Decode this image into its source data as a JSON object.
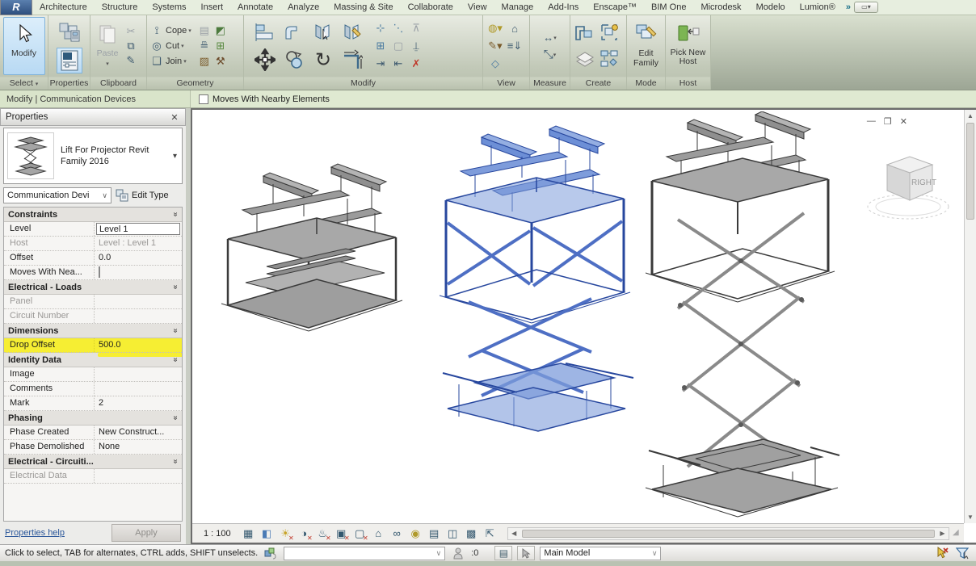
{
  "app": {
    "logo_letter": "R"
  },
  "ribbon": {
    "tabs": [
      "Architecture",
      "Structure",
      "Systems",
      "Insert",
      "Annotate",
      "Analyze",
      "Massing & Site",
      "Collaborate",
      "View",
      "Manage",
      "Add-Ins",
      "Enscape™",
      "BIM One",
      "Microdesk",
      "Modelo",
      "Lumion®"
    ],
    "panels": {
      "select": {
        "label": "Select",
        "button": "Modify"
      },
      "properties": {
        "label": "Properties"
      },
      "clipboard": {
        "label": "Clipboard",
        "paste": "Paste"
      },
      "geometry": {
        "label": "Geometry",
        "cope": "Cope",
        "cut": "Cut",
        "join": "Join"
      },
      "modify": {
        "label": "Modify"
      },
      "view": {
        "label": "View"
      },
      "measure": {
        "label": "Measure"
      },
      "create": {
        "label": "Create"
      },
      "mode": {
        "label": "Mode",
        "edit_family": "Edit Family"
      },
      "host": {
        "label": "Host",
        "pick_new_host": "Pick New Host"
      }
    }
  },
  "options_bar": {
    "context": "Modify | Communication Devices",
    "checkbox_label": "Moves With Nearby Elements",
    "checkbox_checked": false
  },
  "properties_panel": {
    "title": "Properties",
    "type_name": "Lift For Projector Revit Family 2016",
    "category": "Communication Devi",
    "edit_type": "Edit Type",
    "groups": {
      "constraints": {
        "name": "Constraints",
        "rows": {
          "level": {
            "label": "Level",
            "value": "Level 1"
          },
          "host": {
            "label": "Host",
            "value": "Level : Level 1"
          },
          "offset": {
            "label": "Offset",
            "value": "0.0"
          },
          "moves": {
            "label": "Moves With Nea...",
            "value": ""
          }
        }
      },
      "electrical_loads": {
        "name": "Electrical - Loads",
        "rows": {
          "panel": {
            "label": "Panel",
            "value": ""
          },
          "circuit": {
            "label": "Circuit Number",
            "value": ""
          }
        }
      },
      "dimensions": {
        "name": "Dimensions",
        "rows": {
          "drop_offset": {
            "label": "Drop Offset",
            "value": "500.0",
            "highlighted": true
          }
        }
      },
      "identity": {
        "name": "Identity Data",
        "rows": {
          "image": {
            "label": "Image",
            "value": ""
          },
          "comments": {
            "label": "Comments",
            "value": ""
          },
          "mark": {
            "label": "Mark",
            "value": "2"
          }
        }
      },
      "phasing": {
        "name": "Phasing",
        "rows": {
          "created": {
            "label": "Phase Created",
            "value": "New Construct..."
          },
          "demolished": {
            "label": "Phase Demolished",
            "value": "None"
          }
        }
      },
      "electrical_circuiting": {
        "name": "Electrical - Circuiti...",
        "rows": {
          "data": {
            "label": "Electrical Data",
            "value": ""
          }
        }
      }
    },
    "help_link": "Properties help",
    "apply": "Apply"
  },
  "viewport": {
    "viewcube_face": "RIGHT",
    "scale": "1 : 100",
    "models": [
      "lift-collapsed-gray",
      "lift-half-extended-selected-blue",
      "lift-fully-extended-gray"
    ],
    "view_bar_icons": [
      "detail-level",
      "visual-style",
      "sun-path-off",
      "shadows-off",
      "rendering-dialog-off",
      "crop-view-off",
      "crop-region-off",
      "unlocked-view",
      "temporary-hide-isolate",
      "reveal-hidden-elements",
      "temporary-view-properties",
      "displacement-sets",
      "worksharing-display",
      "view-lock"
    ],
    "colors": {
      "selection": "#3e62c4",
      "model": "#8a8a8a",
      "highlight": "#f6ee33"
    }
  },
  "status_bar": {
    "message": "Click to select, TAB for alternates, CTRL adds, SHIFT unselects.",
    "workset_value": "",
    "requests_count": ":0",
    "design_option": "Main Model"
  }
}
